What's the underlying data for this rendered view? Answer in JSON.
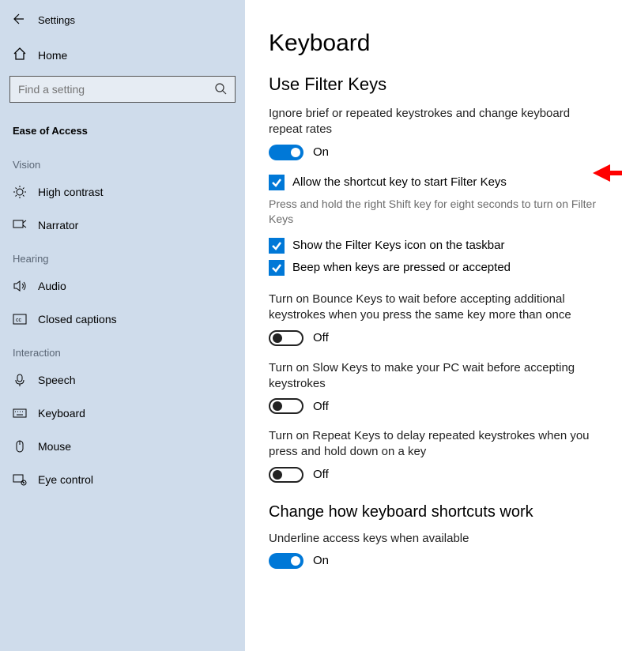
{
  "window": {
    "title": "Settings"
  },
  "sidebar": {
    "home": "Home",
    "search_placeholder": "Find a setting",
    "section": "Ease of Access",
    "groups": [
      {
        "label": "Vision",
        "items": [
          {
            "label": "High contrast"
          },
          {
            "label": "Narrator"
          }
        ]
      },
      {
        "label": "Hearing",
        "items": [
          {
            "label": "Audio"
          },
          {
            "label": "Closed captions"
          }
        ]
      },
      {
        "label": "Interaction",
        "items": [
          {
            "label": "Speech"
          },
          {
            "label": "Keyboard"
          },
          {
            "label": "Mouse"
          },
          {
            "label": "Eye control"
          }
        ]
      }
    ]
  },
  "main": {
    "title": "Keyboard",
    "filter": {
      "heading": "Use Filter Keys",
      "desc": "Ignore brief or repeated keystrokes and change keyboard repeat rates",
      "toggle_state": "On",
      "shortcut_check": "Allow the shortcut key to start Filter Keys",
      "shortcut_hint": "Press and hold the right Shift key for eight seconds to turn on Filter Keys",
      "taskbar_check": "Show the Filter Keys icon on the taskbar",
      "beep_check": "Beep when keys are pressed or accepted",
      "bounce_desc": "Turn on Bounce Keys to wait before accepting additional keystrokes when you press the same key more than once",
      "bounce_state": "Off",
      "slow_desc": "Turn on Slow Keys to make your PC wait before accepting keystrokes",
      "slow_state": "Off",
      "repeat_desc": "Turn on Repeat Keys to delay repeated keystrokes when you press and hold down on a key",
      "repeat_state": "Off"
    },
    "shortcuts": {
      "heading": "Change how keyboard shortcuts work",
      "underline_desc": "Underline access keys when available",
      "underline_state": "On"
    }
  }
}
